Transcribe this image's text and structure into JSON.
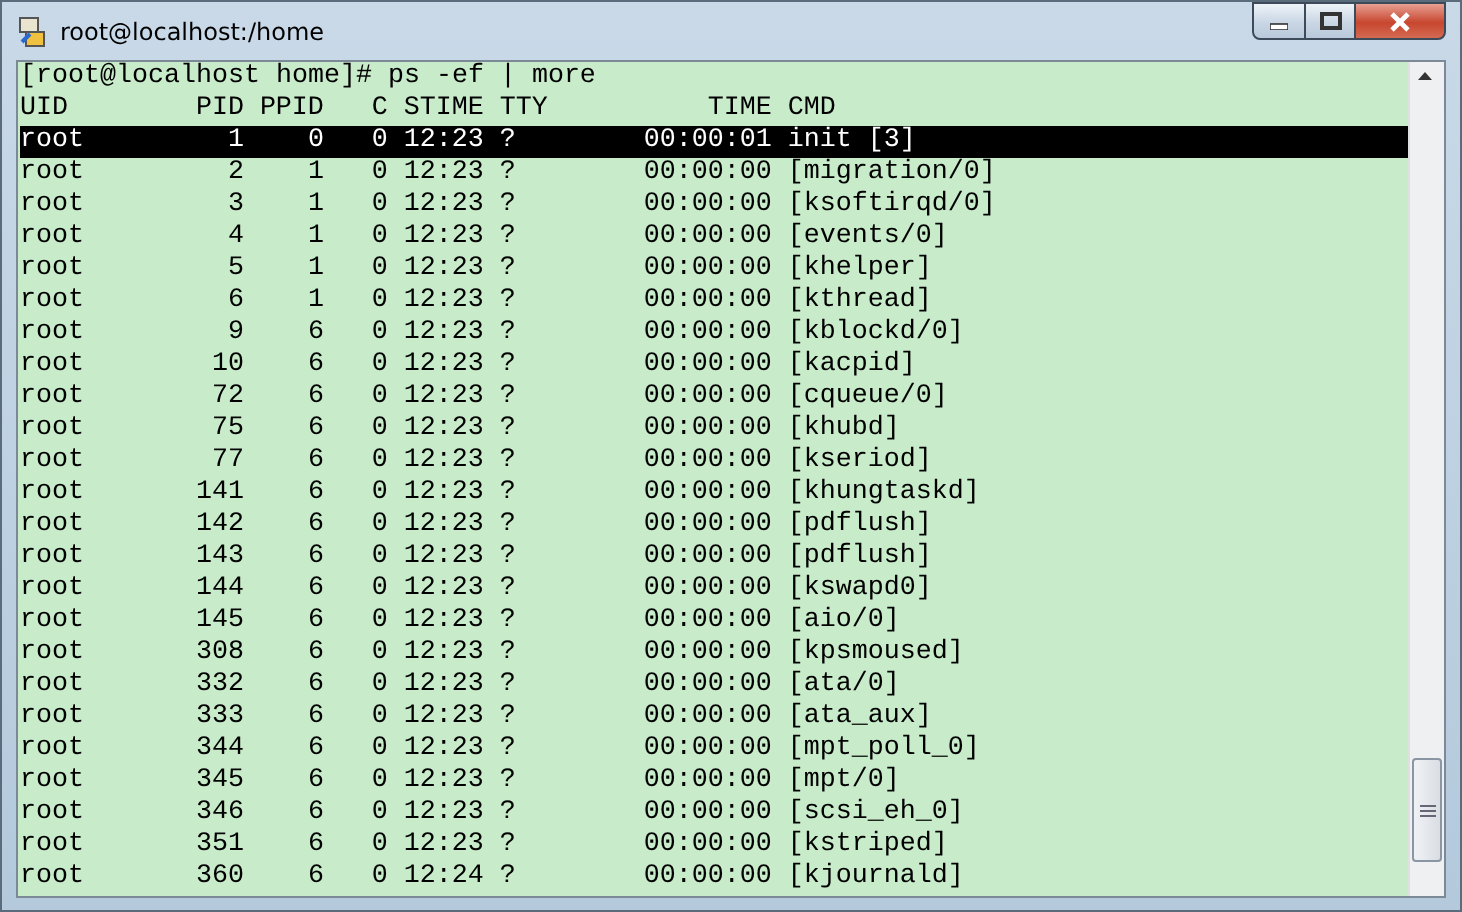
{
  "window": {
    "title": "root@localhost:/home"
  },
  "terminal": {
    "prompt": "[root@localhost home]# ps -ef | more",
    "columns": [
      "UID",
      "PID",
      "PPID",
      "C",
      "STIME",
      "TTY",
      "TIME",
      "CMD"
    ],
    "rows": [
      {
        "uid": "root",
        "pid": "1",
        "ppid": "0",
        "c": "0",
        "stime": "12:23",
        "tty": "?",
        "time": "00:00:01",
        "cmd": "init [3]",
        "selected": true
      },
      {
        "uid": "root",
        "pid": "2",
        "ppid": "1",
        "c": "0",
        "stime": "12:23",
        "tty": "?",
        "time": "00:00:00",
        "cmd": "[migration/0]",
        "selected": false
      },
      {
        "uid": "root",
        "pid": "3",
        "ppid": "1",
        "c": "0",
        "stime": "12:23",
        "tty": "?",
        "time": "00:00:00",
        "cmd": "[ksoftirqd/0]",
        "selected": false
      },
      {
        "uid": "root",
        "pid": "4",
        "ppid": "1",
        "c": "0",
        "stime": "12:23",
        "tty": "?",
        "time": "00:00:00",
        "cmd": "[events/0]",
        "selected": false
      },
      {
        "uid": "root",
        "pid": "5",
        "ppid": "1",
        "c": "0",
        "stime": "12:23",
        "tty": "?",
        "time": "00:00:00",
        "cmd": "[khelper]",
        "selected": false
      },
      {
        "uid": "root",
        "pid": "6",
        "ppid": "1",
        "c": "0",
        "stime": "12:23",
        "tty": "?",
        "time": "00:00:00",
        "cmd": "[kthread]",
        "selected": false
      },
      {
        "uid": "root",
        "pid": "9",
        "ppid": "6",
        "c": "0",
        "stime": "12:23",
        "tty": "?",
        "time": "00:00:00",
        "cmd": "[kblockd/0]",
        "selected": false
      },
      {
        "uid": "root",
        "pid": "10",
        "ppid": "6",
        "c": "0",
        "stime": "12:23",
        "tty": "?",
        "time": "00:00:00",
        "cmd": "[kacpid]",
        "selected": false
      },
      {
        "uid": "root",
        "pid": "72",
        "ppid": "6",
        "c": "0",
        "stime": "12:23",
        "tty": "?",
        "time": "00:00:00",
        "cmd": "[cqueue/0]",
        "selected": false
      },
      {
        "uid": "root",
        "pid": "75",
        "ppid": "6",
        "c": "0",
        "stime": "12:23",
        "tty": "?",
        "time": "00:00:00",
        "cmd": "[khubd]",
        "selected": false
      },
      {
        "uid": "root",
        "pid": "77",
        "ppid": "6",
        "c": "0",
        "stime": "12:23",
        "tty": "?",
        "time": "00:00:00",
        "cmd": "[kseriod]",
        "selected": false
      },
      {
        "uid": "root",
        "pid": "141",
        "ppid": "6",
        "c": "0",
        "stime": "12:23",
        "tty": "?",
        "time": "00:00:00",
        "cmd": "[khungtaskd]",
        "selected": false
      },
      {
        "uid": "root",
        "pid": "142",
        "ppid": "6",
        "c": "0",
        "stime": "12:23",
        "tty": "?",
        "time": "00:00:00",
        "cmd": "[pdflush]",
        "selected": false
      },
      {
        "uid": "root",
        "pid": "143",
        "ppid": "6",
        "c": "0",
        "stime": "12:23",
        "tty": "?",
        "time": "00:00:00",
        "cmd": "[pdflush]",
        "selected": false
      },
      {
        "uid": "root",
        "pid": "144",
        "ppid": "6",
        "c": "0",
        "stime": "12:23",
        "tty": "?",
        "time": "00:00:00",
        "cmd": "[kswapd0]",
        "selected": false
      },
      {
        "uid": "root",
        "pid": "145",
        "ppid": "6",
        "c": "0",
        "stime": "12:23",
        "tty": "?",
        "time": "00:00:00",
        "cmd": "[aio/0]",
        "selected": false
      },
      {
        "uid": "root",
        "pid": "308",
        "ppid": "6",
        "c": "0",
        "stime": "12:23",
        "tty": "?",
        "time": "00:00:00",
        "cmd": "[kpsmoused]",
        "selected": false
      },
      {
        "uid": "root",
        "pid": "332",
        "ppid": "6",
        "c": "0",
        "stime": "12:23",
        "tty": "?",
        "time": "00:00:00",
        "cmd": "[ata/0]",
        "selected": false
      },
      {
        "uid": "root",
        "pid": "333",
        "ppid": "6",
        "c": "0",
        "stime": "12:23",
        "tty": "?",
        "time": "00:00:00",
        "cmd": "[ata_aux]",
        "selected": false
      },
      {
        "uid": "root",
        "pid": "344",
        "ppid": "6",
        "c": "0",
        "stime": "12:23",
        "tty": "?",
        "time": "00:00:00",
        "cmd": "[mpt_poll_0]",
        "selected": false
      },
      {
        "uid": "root",
        "pid": "345",
        "ppid": "6",
        "c": "0",
        "stime": "12:23",
        "tty": "?",
        "time": "00:00:00",
        "cmd": "[mpt/0]",
        "selected": false
      },
      {
        "uid": "root",
        "pid": "346",
        "ppid": "6",
        "c": "0",
        "stime": "12:23",
        "tty": "?",
        "time": "00:00:00",
        "cmd": "[scsi_eh_0]",
        "selected": false
      },
      {
        "uid": "root",
        "pid": "351",
        "ppid": "6",
        "c": "0",
        "stime": "12:23",
        "tty": "?",
        "time": "00:00:00",
        "cmd": "[kstriped]",
        "selected": false
      },
      {
        "uid": "root",
        "pid": "360",
        "ppid": "6",
        "c": "0",
        "stime": "12:24",
        "tty": "?",
        "time": "00:00:00",
        "cmd": "[kjournald]",
        "selected": false
      }
    ]
  }
}
